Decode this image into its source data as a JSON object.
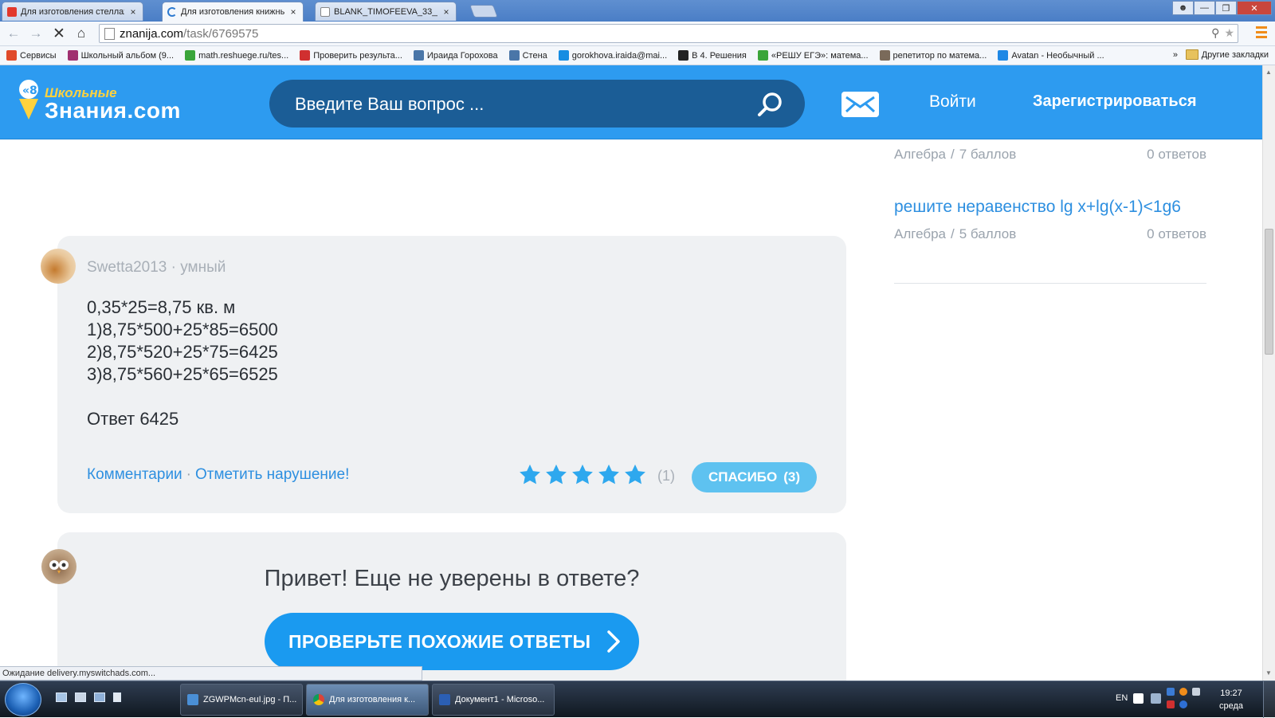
{
  "browser": {
    "tabs": [
      {
        "title": "Для изготовления стеллаж",
        "favicon_color": "#e2382c",
        "active": false
      },
      {
        "title": "Для изготовления книжны",
        "favicon_color": "#2d7ad0",
        "active": true
      },
      {
        "title": "BLANK_TIMOFEEVA_33___3",
        "favicon_color": "#ffffff",
        "active": false
      }
    ],
    "tab_close_glyph": "×",
    "url_host": "znanija.com",
    "url_path": "/task/6769575",
    "bookmarks": [
      {
        "label": "Сервисы",
        "icon": "apps-grid-icon",
        "color": "#e04a2a"
      },
      {
        "label": "Школьный альбом (9...",
        "icon": "eye-icon",
        "color": "#a03070"
      },
      {
        "label": "math.reshuege.ru/tes...",
        "icon": "check-icon",
        "color": "#3aa53a"
      },
      {
        "label": "Проверить результа...",
        "icon": "person-icon",
        "color": "#d03030"
      },
      {
        "label": "Ираида Горохова",
        "icon": "vk-icon",
        "color": "#4a76a8"
      },
      {
        "label": "Стена",
        "icon": "vk-icon",
        "color": "#4a76a8"
      },
      {
        "label": "gorokhova.iraida@mai...",
        "icon": "mail-ru-icon",
        "color": "#168de2"
      },
      {
        "label": "В 4. Решения",
        "icon": "x-icon",
        "color": "#222222"
      },
      {
        "label": "«РЕШУ ЕГЭ»: матема...",
        "icon": "check-icon",
        "color": "#3aa53a"
      },
      {
        "label": "репетитор по матема...",
        "icon": "photo-icon",
        "color": "#7a6a5a"
      },
      {
        "label": "Avatan - Необычный ...",
        "icon": "avatan-icon",
        "color": "#1e88e5"
      }
    ],
    "bookmarks_more": "»",
    "bookmarks_other": "Другие закладки"
  },
  "site": {
    "logo_small": "Школьные",
    "logo_big": "Знания.com",
    "search_placeholder": "Введите Ваш вопрос ...",
    "login": "Войти",
    "register": "Зарегистрироваться"
  },
  "sidebar": {
    "q1": {
      "subject": "Алгебра",
      "sep": "/",
      "points": "7 баллов",
      "answers": "0 ответов"
    },
    "q2": {
      "title": "решите неравенство lg x+lg(x-1)<1g6",
      "subject": "Алгебра",
      "sep": "/",
      "points": "5 баллов",
      "answers": "0 ответов"
    }
  },
  "answer": {
    "author": "Swetta2013 · умный",
    "lines": [
      "0,35*25=8,75 кв. м",
      "1)8,75*500+25*85=6500",
      "2)8,75*520+25*75=6425",
      "3)8,75*560+25*65=6525"
    ],
    "final": "Ответ 6425",
    "comments": "Комментарии",
    "dot": "·",
    "report": "Отметить нарушение!",
    "rating": 5,
    "rating_count": "(1)",
    "thanks_label": "СПАСИБО",
    "thanks_count": "(3)",
    "star_color": "#2ea8ee"
  },
  "help": {
    "title": "Привет! Еще не уверены в ответе?",
    "button": "ПРОВЕРЬТЕ ПОХОЖИЕ ОТВЕТЫ"
  },
  "status_text": "Ожидание delivery.myswitchads.com...",
  "taskbar": {
    "items": [
      {
        "label": "ZGWPMcn-euI.jpg - П...",
        "icon_color": "#4a8fd6",
        "active": false
      },
      {
        "label": "Для изготовления к...",
        "icon_color": "#e9b43a",
        "active": true
      },
      {
        "label": "Документ1 - Microso...",
        "icon_color": "#2b5fb4",
        "active": false
      }
    ],
    "lang": "EN",
    "time": "19:27",
    "day": "среда"
  }
}
